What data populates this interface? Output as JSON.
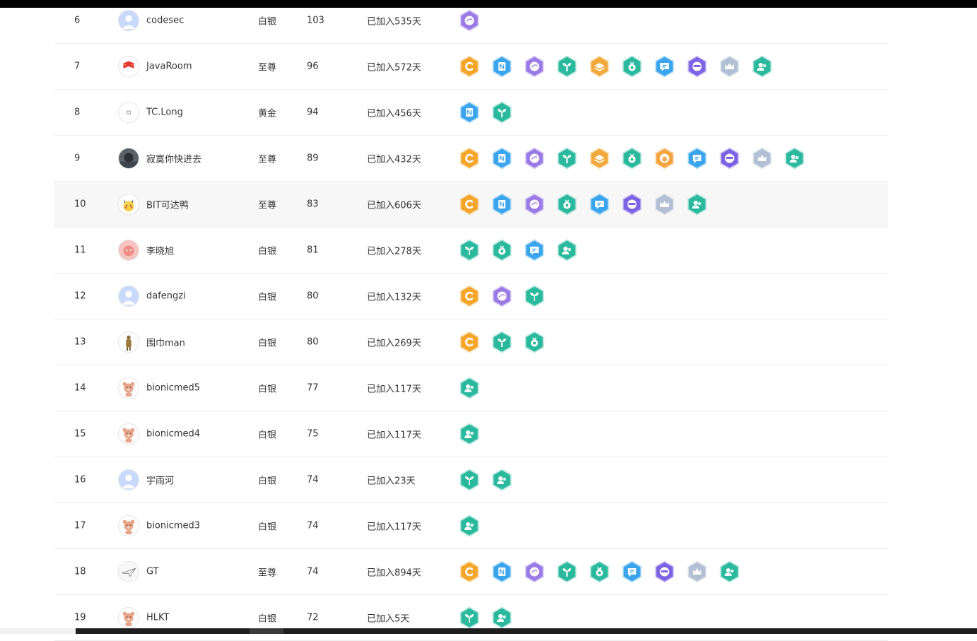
{
  "colors": {
    "orange": "#f4a62a",
    "blue": "#3aa4ec",
    "purple": "#9a7be6",
    "green": "#2bb99e",
    "amber": "#f2a93b",
    "indigo": "#7b63e4",
    "silver": "#b2bfd4",
    "lion": "#f3a43e",
    "text": "#333333",
    "divider": "#ececec"
  },
  "rows": [
    {
      "rank": "6",
      "avatar": "default-avatar-icon",
      "name": "codesec",
      "level": "白银",
      "score": "103",
      "joined": "已加入535天",
      "badges": [
        "orbit-badge-icon"
      ]
    },
    {
      "rank": "7",
      "avatar": "flag-avatar-icon",
      "name": "JavaRoom",
      "level": "至尊",
      "score": "96",
      "joined": "已加入572天",
      "badges": [
        "c-badge-icon",
        "note-badge-icon",
        "orbit-badge-icon",
        "sprout-badge-icon",
        "book-badge-icon",
        "medal-badge-icon",
        "message-badge-icon",
        "mask-badge-icon",
        "crown-badge-icon",
        "people-badge-icon"
      ]
    },
    {
      "rank": "8",
      "avatar": "minimal-avatar-icon",
      "name": "TC.Long",
      "level": "黄金",
      "score": "94",
      "joined": "已加入456天",
      "badges": [
        "note-badge-icon",
        "sprout-badge-icon"
      ]
    },
    {
      "rank": "9",
      "avatar": "dark-photo-avatar-icon",
      "name": "寂寞你快进去",
      "level": "至尊",
      "score": "89",
      "joined": "已加入432天",
      "badges": [
        "c-badge-icon",
        "note-badge-icon",
        "orbit-badge-icon",
        "sprout-badge-icon",
        "book-badge-icon",
        "medal-badge-icon",
        "lion-badge-icon",
        "message-badge-icon",
        "mask-badge-icon",
        "crown-badge-icon",
        "people-badge-icon"
      ]
    },
    {
      "rank": "10",
      "avatar": "pikachu-avatar-icon",
      "name": "BIT可达鸭",
      "level": "至尊",
      "score": "83",
      "joined": "已加入606天",
      "badges": [
        "c-badge-icon",
        "note-badge-icon",
        "orbit-badge-icon",
        "medal-badge-icon",
        "message-badge-icon",
        "mask-badge-icon",
        "crown-badge-icon",
        "people-badge-icon"
      ]
    },
    {
      "rank": "11",
      "avatar": "pink-cat-avatar-icon",
      "name": "李晓旭",
      "level": "白银",
      "score": "81",
      "joined": "已加入278天",
      "badges": [
        "sprout-badge-icon",
        "medal-badge-icon",
        "message-badge-icon",
        "people-badge-icon"
      ]
    },
    {
      "rank": "12",
      "avatar": "default-avatar-icon",
      "name": "dafengzi",
      "level": "白银",
      "score": "80",
      "joined": "已加入132天",
      "badges": [
        "c-badge-icon",
        "orbit-badge-icon",
        "sprout-badge-icon"
      ]
    },
    {
      "rank": "13",
      "avatar": "figure-avatar-icon",
      "name": "围巾man",
      "level": "白银",
      "score": "80",
      "joined": "已加入269天",
      "badges": [
        "c-badge-icon",
        "sprout-badge-icon",
        "medal-badge-icon"
      ]
    },
    {
      "rank": "14",
      "avatar": "bear-avatar-icon",
      "name": "bionicmed5",
      "level": "白银",
      "score": "77",
      "joined": "已加入117天",
      "badges": [
        "people-badge-icon"
      ]
    },
    {
      "rank": "15",
      "avatar": "bear-avatar-icon",
      "name": "bionicmed4",
      "level": "白银",
      "score": "75",
      "joined": "已加入117天",
      "badges": [
        "people-badge-icon"
      ]
    },
    {
      "rank": "16",
      "avatar": "default-avatar-icon",
      "name": "宇雨河",
      "level": "白银",
      "score": "74",
      "joined": "已加入23天",
      "badges": [
        "sprout-badge-icon",
        "people-badge-icon"
      ]
    },
    {
      "rank": "17",
      "avatar": "bear-avatar-icon",
      "name": "bionicmed3",
      "level": "白银",
      "score": "74",
      "joined": "已加入117天",
      "badges": [
        "people-badge-icon"
      ]
    },
    {
      "rank": "18",
      "avatar": "plane-avatar-icon",
      "name": "GT",
      "level": "至尊",
      "score": "74",
      "joined": "已加入894天",
      "badges": [
        "c-badge-icon",
        "note-badge-icon",
        "orbit-badge-icon",
        "sprout-badge-icon",
        "medal-badge-icon",
        "message-badge-icon",
        "mask-badge-icon",
        "crown-badge-icon",
        "people-badge-icon"
      ]
    },
    {
      "rank": "19",
      "avatar": "bear-avatar-icon",
      "name": "HLKT",
      "level": "白银",
      "score": "72",
      "joined": "已加入5天",
      "badges": [
        "sprout-badge-icon",
        "people-badge-icon"
      ]
    }
  ],
  "highlighted_rank": "10"
}
